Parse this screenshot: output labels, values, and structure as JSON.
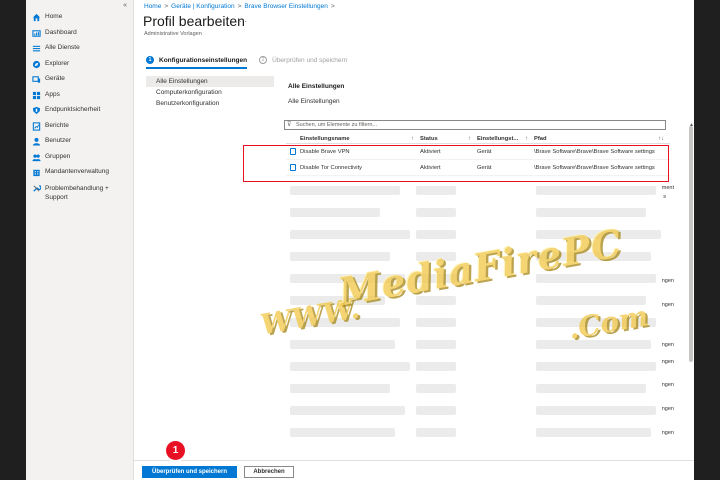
{
  "sidebar": {
    "collapse_glyph": "«",
    "items": [
      {
        "label": "Home",
        "icon": "home-icon"
      },
      {
        "label": "Dashboard",
        "icon": "dashboard-icon"
      },
      {
        "label": "Alle Dienste",
        "icon": "list-icon"
      },
      {
        "label": "Explorer",
        "icon": "explorer-icon"
      },
      {
        "label": "Geräte",
        "icon": "devices-icon"
      },
      {
        "label": "Apps",
        "icon": "apps-icon"
      },
      {
        "label": "Endpunktsicherheit",
        "icon": "shield-icon"
      },
      {
        "label": "Berichte",
        "icon": "reports-icon"
      },
      {
        "label": "Benutzer",
        "icon": "user-icon"
      },
      {
        "label": "Gruppen",
        "icon": "groups-icon"
      },
      {
        "label": "Mandantenverwaltung",
        "icon": "tenant-icon"
      },
      {
        "label": "Problembehandlung + Support",
        "icon": "wrench-icon"
      }
    ]
  },
  "breadcrumb": [
    "Home",
    "Geräte | Konfiguration",
    "Brave Browser Einstellungen"
  ],
  "page": {
    "title": "Profil bearbeiten",
    "more": "···",
    "subtitle": "Administrative Vorlagen"
  },
  "steps": [
    {
      "num": "1",
      "label": "Konfigurationseinstellungen",
      "state": "active"
    },
    {
      "num": "2",
      "label": "Überprüfen und speichern",
      "state": "inactive"
    }
  ],
  "tree": [
    "Alle Einstellungen",
    "Computerkonfiguration",
    "Benutzerkonfiguration"
  ],
  "panel": {
    "heading": "Alle Einstellungen",
    "subheading": "Alle Einstellungen",
    "search_placeholder": "Suchen, um Elemente zu filtern..."
  },
  "table": {
    "columns": [
      "Einstellungsname",
      "Status",
      "Einstellungst...",
      "Pfad"
    ],
    "sort_glyph": "↑↓",
    "rows": [
      {
        "name": "Disable Brave VPN",
        "status": "Aktiviert",
        "type": "Gerät",
        "path": "\\Brave Software\\Brave\\Brave Software settings"
      },
      {
        "name": "Disable Tor Connectivity",
        "status": "Aktiviert",
        "type": "Gerät",
        "path": "\\Brave Software\\Brave\\Brave Software settings"
      }
    ],
    "fragments": [
      "ment",
      "s",
      "ngen",
      "ngen",
      "ngen",
      "ngen",
      "ngen",
      "ngen",
      "ngen"
    ]
  },
  "footer": {
    "primary": "Überprüfen und speichern",
    "secondary": "Abbrechen"
  },
  "callout": "1",
  "watermark": {
    "prefix": "WWW.",
    "main": "MediaFirePC",
    "suffix": ".Com"
  },
  "colors": {
    "accent": "#0078d4",
    "highlight": "#e81123",
    "watermark": "#f2c94c"
  }
}
